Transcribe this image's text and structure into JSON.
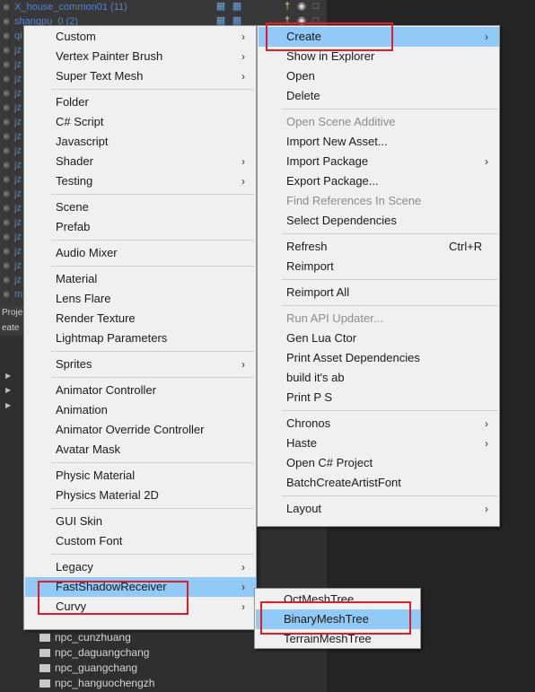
{
  "hierarchy": {
    "rows": [
      {
        "name": "X_house_common01 (11)",
        "show_name": true
      },
      {
        "name": "shangpu_0 (2)",
        "show_name": true
      },
      {
        "name": "qi",
        "show_name": true
      },
      {
        "name": "jz",
        "show_name": true
      },
      {
        "name": "jz",
        "show_name": true
      },
      {
        "name": "jz",
        "show_name": true
      },
      {
        "name": "jz",
        "show_name": true
      },
      {
        "name": "jz",
        "show_name": true
      },
      {
        "name": "jz",
        "show_name": true
      },
      {
        "name": "jz",
        "show_name": true
      },
      {
        "name": "jz",
        "show_name": true
      },
      {
        "name": "jz",
        "show_name": true
      },
      {
        "name": "jz",
        "show_name": true
      },
      {
        "name": "jz",
        "show_name": true
      },
      {
        "name": "jz",
        "show_name": true
      },
      {
        "name": "jz",
        "show_name": true
      },
      {
        "name": "jz",
        "show_name": true
      },
      {
        "name": "jz",
        "show_name": true
      },
      {
        "name": "jz",
        "show_name": true
      },
      {
        "name": "jz",
        "show_name": true
      },
      {
        "name": "m",
        "show_name": true
      }
    ]
  },
  "project": {
    "tab_label": "Proje",
    "toolbar_label": "eate",
    "folders": [
      "npc_cunzhuang",
      "npc_daguangchang",
      "npc_guangchang",
      "npc_hanguochengzh"
    ]
  },
  "menu_left": {
    "items": [
      {
        "label": "Custom",
        "submenu": true
      },
      {
        "label": "Vertex Painter Brush",
        "submenu": true
      },
      {
        "label": "Super Text Mesh",
        "submenu": true
      },
      {
        "label": "Folder"
      },
      {
        "label": "C# Script"
      },
      {
        "label": "Javascript"
      },
      {
        "label": "Shader",
        "submenu": true
      },
      {
        "label": "Testing",
        "submenu": true
      },
      {
        "label": "Scene"
      },
      {
        "label": "Prefab"
      },
      {
        "label": "Audio Mixer"
      },
      {
        "label": "Material"
      },
      {
        "label": "Lens Flare"
      },
      {
        "label": "Render Texture"
      },
      {
        "label": "Lightmap Parameters"
      },
      {
        "label": "Sprites",
        "submenu": true
      },
      {
        "label": "Animator Controller"
      },
      {
        "label": "Animation"
      },
      {
        "label": "Animator Override Controller"
      },
      {
        "label": "Avatar Mask"
      },
      {
        "label": "Physic Material"
      },
      {
        "label": "Physics Material 2D"
      },
      {
        "label": "GUI Skin"
      },
      {
        "label": "Custom Font"
      },
      {
        "label": "Legacy",
        "submenu": true
      },
      {
        "label": "FastShadowReceiver",
        "submenu": true,
        "highlighted": true
      },
      {
        "label": "Curvy",
        "submenu": true
      }
    ]
  },
  "menu_right": {
    "items": [
      {
        "label": "Create",
        "submenu": true,
        "highlighted": true
      },
      {
        "label": "Show in Explorer"
      },
      {
        "label": "Open"
      },
      {
        "label": "Delete"
      },
      {
        "label": "Open Scene Additive",
        "disabled": true
      },
      {
        "label": "Import New Asset..."
      },
      {
        "label": "Import Package",
        "submenu": true
      },
      {
        "label": "Export Package..."
      },
      {
        "label": "Find References In Scene",
        "disabled": true
      },
      {
        "label": "Select Dependencies"
      },
      {
        "label": "Refresh",
        "shortcut": "Ctrl+R"
      },
      {
        "label": "Reimport"
      },
      {
        "label": "Reimport All"
      },
      {
        "label": "Run API Updater...",
        "disabled": true
      },
      {
        "label": "Gen Lua Ctor"
      },
      {
        "label": "Print Asset Dependencies"
      },
      {
        "label": "build it's ab"
      },
      {
        "label": "Print P S"
      },
      {
        "label": "Chronos",
        "submenu": true
      },
      {
        "label": "Haste",
        "submenu": true
      },
      {
        "label": "Open C# Project"
      },
      {
        "label": "BatchCreateArtistFont"
      },
      {
        "label": "Layout",
        "submenu": true
      }
    ]
  },
  "menu_sub": {
    "items": [
      {
        "label": "OctMeshTree"
      },
      {
        "label": "BinaryMeshTree",
        "highlighted": true
      },
      {
        "label": "TerrainMeshTree"
      }
    ]
  },
  "icons": {
    "submenu_arrow": "chevron-right-icon",
    "folder": "folder-icon",
    "gameobject": "gameobject-icon"
  },
  "colors": {
    "highlight": "#91c9f7",
    "annotation_red": "#e01e2a",
    "menu_bg": "#f0f0f0",
    "hierarchy_text": "#5a84c8"
  }
}
